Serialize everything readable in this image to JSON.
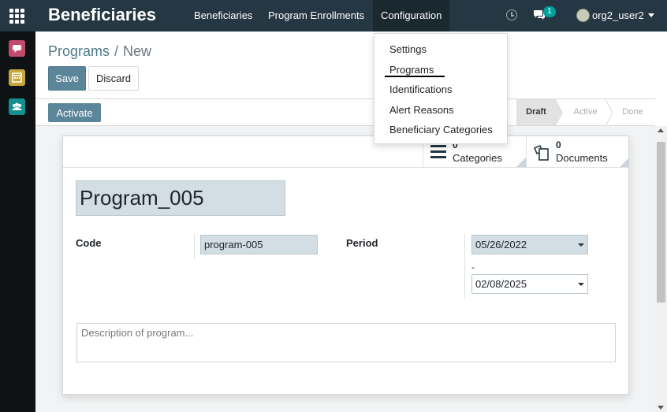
{
  "app": {
    "title": "Beneficiaries"
  },
  "nav": {
    "items": [
      {
        "label": "Beneficiaries"
      },
      {
        "label": "Program Enrollments"
      },
      {
        "label": "Configuration"
      }
    ],
    "user": "org2_user2",
    "messages_count": "1"
  },
  "config_menu": {
    "items": [
      {
        "label": "Settings"
      },
      {
        "label": "Programs"
      },
      {
        "label": "Identifications"
      },
      {
        "label": "Alert Reasons"
      },
      {
        "label": "Beneficiary Categories"
      }
    ]
  },
  "breadcrumb": {
    "parent": "Programs",
    "separator": "/",
    "current": "New"
  },
  "buttons": {
    "save": "Save",
    "discard": "Discard",
    "activate": "Activate"
  },
  "stages": [
    {
      "label": "Draft",
      "current": true
    },
    {
      "label": "Active",
      "current": false
    },
    {
      "label": "Done",
      "current": false
    }
  ],
  "smart_buttons": {
    "categories": {
      "count": "0",
      "label": "Categories"
    },
    "documents": {
      "count": "0",
      "label": "Documents"
    }
  },
  "form": {
    "name": "Program_005",
    "code_label": "Code",
    "code_value": "program-005",
    "period_label": "Period",
    "period_start": "05/26/2022",
    "period_sep": "-",
    "period_end": "02/08/2025",
    "description_placeholder": "Description of program..."
  },
  "colors": {
    "navbar": "#243742",
    "primary": "#5b8598",
    "link": "#4e7a8c",
    "accent_badge": "#00a09d"
  }
}
